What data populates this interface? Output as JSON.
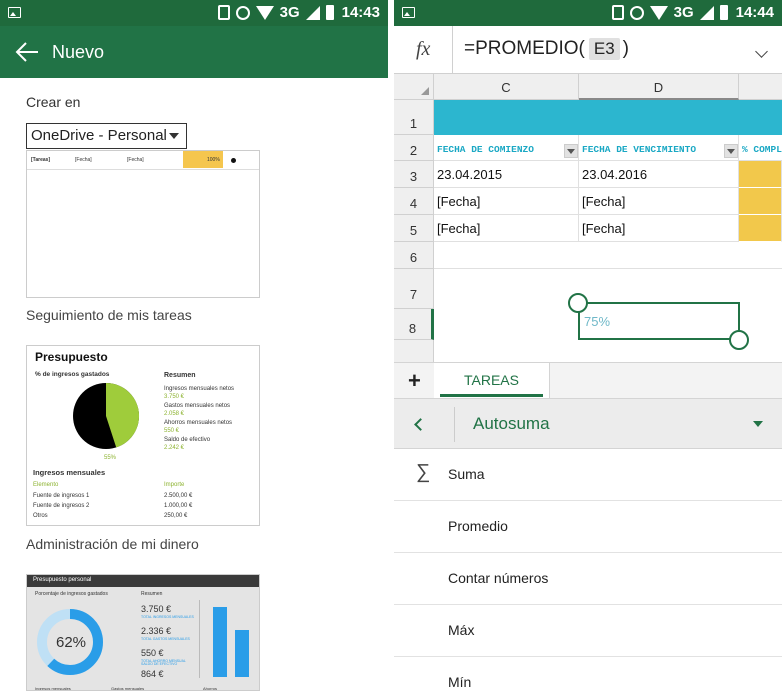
{
  "left": {
    "status": {
      "network": "3G",
      "time": "14:43"
    },
    "appbar": {
      "title": "Nuevo"
    },
    "crear_en": {
      "label": "Crear en",
      "value": "OneDrive - Personal"
    },
    "thumb1": {
      "rows": [
        {
          "c1": "[Tareas]",
          "c2": "[Fecha]",
          "c3": "[Fecha]",
          "c4": "100%"
        }
      ]
    },
    "templates": [
      {
        "name": "Seguimiento de mis tareas"
      },
      {
        "name": "Administración de mi dinero"
      }
    ],
    "presupuesto": {
      "title": "Presupuesto",
      "pie_label": "% de ingresos gastados",
      "pie_pct": "55%",
      "resumen": "Resumen",
      "items": [
        {
          "label": "Ingresos mensuales netos",
          "value": "3.750 €"
        },
        {
          "label": "Gastos mensuales netos",
          "value": "2.058 €"
        },
        {
          "label": "Ahorros mensuales netos",
          "value": "550 €"
        },
        {
          "label": "Saldo de efectivo",
          "value": "2.242 €"
        }
      ],
      "ingresos_title": "Ingresos mensuales",
      "col_elemento": "Elemento",
      "col_importe": "Importe",
      "rows": [
        {
          "label": "Fuente de ingresos 1",
          "value": "2.500,00 €"
        },
        {
          "label": "Fuente de ingresos 2",
          "value": "1.000,00 €"
        },
        {
          "label": "Otros",
          "value": "250,00 €"
        }
      ]
    },
    "personal": {
      "header": "Presupuesto personal",
      "subtitle": "Porcentaje de ingresos gastados",
      "resumen": "Resumen",
      "pct": "62%",
      "vals": [
        "3.750 €",
        "2.336 €",
        "550 €",
        "864 €"
      ],
      "val_labels": [
        "TOTAL INGRESOS MENSUALES",
        "TOTAL GASTOS MENSUALES",
        "TOTAL AHORRO MENSUAL",
        "SALDO DE EFECTIVO"
      ],
      "footer": [
        "Ingresos mensuales",
        "Gastos mensuales",
        "Ahorros"
      ]
    }
  },
  "right": {
    "status": {
      "network": "3G",
      "time": "14:44"
    },
    "fx": {
      "label": "fx",
      "formula_prefix": "=PROMEDIO(",
      "ref": "E3",
      "formula_suffix": ")"
    },
    "columns": [
      "C",
      "D"
    ],
    "rows": [
      "1",
      "2",
      "3",
      "4",
      "5",
      "6",
      "7",
      "8"
    ],
    "headers": {
      "c": "FECHA DE COMIENZO",
      "d": "FECHA DE VENCIMIENTO",
      "e": "% COMPLE"
    },
    "data": [
      {
        "c": "23.04.2015",
        "d": "23.04.2016"
      },
      {
        "c": "[Fecha]",
        "d": "[Fecha]"
      },
      {
        "c": "[Fecha]",
        "d": "[Fecha]"
      }
    ],
    "selected_value": "75%",
    "sheet_tab": "TAREAS",
    "function_category": "Autosuma",
    "functions": [
      "Suma",
      "Promedio",
      "Contar números",
      "Máx",
      "Mín"
    ],
    "colors": {
      "excel_green": "#217346",
      "header_teal": "#2cb6cf",
      "pct_yellow": "#f2c84b"
    }
  }
}
